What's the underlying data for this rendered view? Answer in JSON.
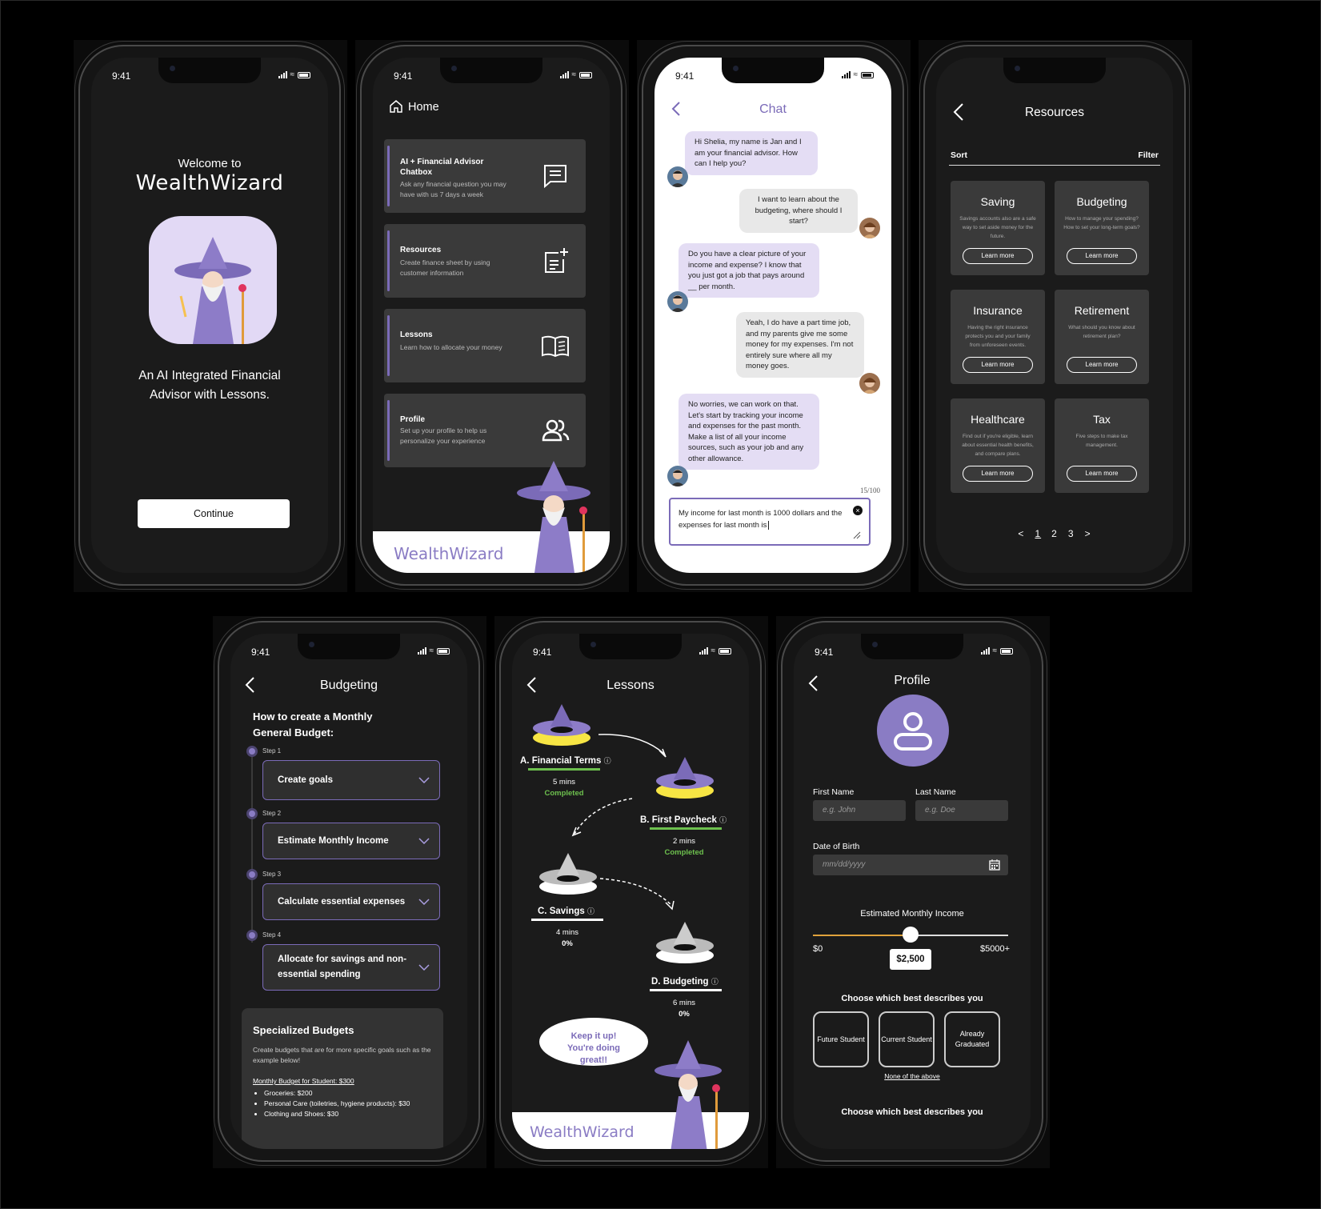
{
  "status_time": "9:41",
  "welcome": {
    "pre_title": "Welcome to",
    "brand": "WealthWizard",
    "tagline": "An AI Integrated Financial Advisor with Lessons.",
    "continue_label": "Continue"
  },
  "home": {
    "title": "Home",
    "cards": [
      {
        "title": "AI + Financial Advisor Chatbox",
        "desc": "Ask any financial question you may have with us 7 days a week",
        "icon": "chat-icon"
      },
      {
        "title": "Resources",
        "desc": "Create finance sheet by using customer information",
        "icon": "add-note-icon"
      },
      {
        "title": "Lessons",
        "desc": "Learn how to allocate your money",
        "icon": "book-icon"
      },
      {
        "title": "Profile",
        "desc": "Set up your profile to help us personalize your experience",
        "icon": "users-icon"
      }
    ],
    "brand": "WealthWizard"
  },
  "chat": {
    "title": "Chat",
    "messages": [
      {
        "from": "advisor",
        "text": "Hi Shelia, my name is Jan and I am your financial advisor. How can I help you?"
      },
      {
        "from": "user",
        "text": "I want to learn about the budgeting, where should I start?"
      },
      {
        "from": "advisor",
        "text": "Do you have a clear picture of your income and expense? I know that you just got a job that pays around __ per month."
      },
      {
        "from": "user",
        "text": "Yeah, I do have a part time job, and my parents give me some money for my expenses. I'm not entirely sure where all my money goes."
      },
      {
        "from": "advisor",
        "text": "No worries, we can work on that. Let's start by tracking your income and expenses for the past month. Make a list of all your income sources, such as your job and any other allowance."
      }
    ],
    "char_count": "15/100",
    "input_value": "My income for last month is 1000 dollars and the expenses for last month is"
  },
  "resources": {
    "title": "Resources",
    "sort_label": "Sort",
    "filter_label": "Filter",
    "tiles": [
      {
        "title": "Saving",
        "desc": "Savings accounts also are a safe way to set aside money for the future."
      },
      {
        "title": "Budgeting",
        "desc": "How to manage your spending? How to set your long-term goals?"
      },
      {
        "title": "Insurance",
        "desc": "Having the right insurance protects you and your family from unforeseen events."
      },
      {
        "title": "Retirement",
        "desc": "What should you know about retirement plan?"
      },
      {
        "title": "Healthcare",
        "desc": "Find out if you're eligible, learn about essential health benefits, and compare plans."
      },
      {
        "title": "Tax",
        "desc": "Five steps to make tax management."
      }
    ],
    "learn_more": "Learn more",
    "pagination": {
      "prev": "<",
      "pages": [
        "1",
        "2",
        "3"
      ],
      "next": ">"
    }
  },
  "budgeting": {
    "title": "Budgeting",
    "heading": "How to create a Monthly General Budget:",
    "steps": [
      {
        "label": "Step 1",
        "text": "Create goals"
      },
      {
        "label": "Step 2",
        "text": "Estimate Monthly Income"
      },
      {
        "label": "Step 3",
        "text": "Calculate essential expenses"
      },
      {
        "label": "Step 4",
        "text": "Allocate for savings and non-essential spending"
      }
    ],
    "special": {
      "title": "Specialized Budgets",
      "desc": "Create budgets that are for more specific goals such as the example below!",
      "example_title": "Monthly Budget for Student: $300",
      "items": [
        "Groceries: $200",
        "Personal Care (toiletries, hygiene products): $30",
        "Clothing and Shoes: $30"
      ]
    }
  },
  "lessons": {
    "title": "Lessons",
    "items": [
      {
        "label": "A. Financial Terms",
        "mins": "5 mins",
        "status": "Completed",
        "progress": 1.0
      },
      {
        "label": "B. First Paycheck",
        "mins": "2 mins",
        "status": "Completed",
        "progress": 1.0
      },
      {
        "label": "C. Savings",
        "mins": "4 mins",
        "status": "0%",
        "progress": 0
      },
      {
        "label": "D. Budgeting",
        "mins": "6 mins",
        "status": "0%",
        "progress": 0
      }
    ],
    "speech": "Keep it up! You're doing great!!",
    "brand": "WealthWizard"
  },
  "profile": {
    "title": "Profile",
    "first_name_label": "First Name",
    "first_name_placeholder": "e.g. John",
    "last_name_label": "Last Name",
    "last_name_placeholder": "e.g. Doe",
    "dob_label": "Date of Birth",
    "dob_placeholder": "mm/dd/yyyy",
    "income_label": "Estimated Monthly Income",
    "income_min": "$0",
    "income_max": "$5000+",
    "income_value": "$2,500",
    "income_fraction": 0.5,
    "describe_label": "Choose which best describes you",
    "options": [
      "Future Student",
      "Current Student",
      "Already Graduated"
    ],
    "none_option": "None of the above",
    "describe_label_2": "Choose which best describes you"
  },
  "colors": {
    "accent": "#8a7cc4",
    "completed": "#6dc04e",
    "bg": "#1b1b1b",
    "card": "#3a3a3a"
  }
}
